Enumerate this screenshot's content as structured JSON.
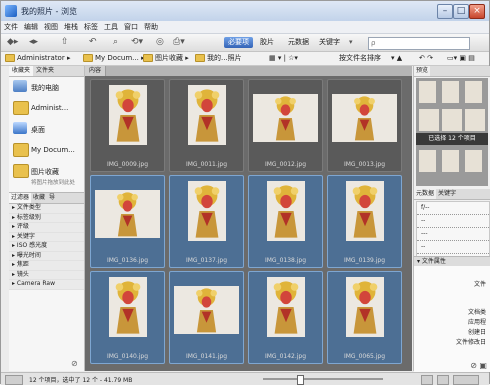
{
  "title": "我的照片 - 浏览",
  "menu": [
    "文件",
    "编辑",
    "视图",
    "堆栈",
    "标签",
    "工具",
    "窗口",
    "帮助"
  ],
  "toolbar": {
    "segments": [
      "必要项",
      "胶片",
      "元数据",
      "关键字"
    ],
    "search_placeholder": "ρ"
  },
  "path": {
    "crumbs": [
      "Administrator",
      "My Docum...",
      "图片收藏",
      "我的...照片"
    ],
    "sort_label": "按文件名排序"
  },
  "left": {
    "tabs": [
      "收藏夹",
      "文件夹"
    ],
    "favorites": [
      "我的电脑",
      "Administ...",
      "桌面",
      "My Docum...",
      "图片收藏",
      "将图片拖放到此处"
    ],
    "filter_tabs": [
      "过滤器",
      "收藏",
      "导"
    ],
    "filters": [
      "文件类型",
      "标签级别",
      "评级",
      "关键字",
      "ISO 感光度",
      "曝光时间",
      "焦距",
      "镜头",
      "Camera Raw"
    ]
  },
  "content": {
    "tab_label": "内容",
    "thumbnails": [
      {
        "name": "IMG_0009.jpg",
        "selected": false,
        "orient": "portrait"
      },
      {
        "name": "IMG_0011.jpg",
        "selected": false,
        "orient": "portrait"
      },
      {
        "name": "IMG_0012.jpg",
        "selected": false,
        "orient": "landscape"
      },
      {
        "name": "IMG_0013.jpg",
        "selected": false,
        "orient": "landscape"
      },
      {
        "name": "IMG_0136.jpg",
        "selected": true,
        "orient": "landscape"
      },
      {
        "name": "IMG_0137.jpg",
        "selected": true,
        "orient": "portrait"
      },
      {
        "name": "IMG_0138.jpg",
        "selected": true,
        "orient": "portrait"
      },
      {
        "name": "IMG_0139.jpg",
        "selected": true,
        "orient": "portrait"
      },
      {
        "name": "IMG_0140.jpg",
        "selected": true,
        "orient": "portrait"
      },
      {
        "name": "IMG_0141.jpg",
        "selected": true,
        "orient": "landscape"
      },
      {
        "name": "IMG_0142.jpg",
        "selected": true,
        "orient": "portrait"
      },
      {
        "name": "IMG_0065.jpg",
        "selected": true,
        "orient": "portrait"
      }
    ]
  },
  "right": {
    "tabs": [
      "预览",
      "元数据",
      "关键字"
    ],
    "overlay_text": "已选择 12 个项目",
    "meta_header": "文件属性",
    "meta_keys": [
      "文件",
      "文档类",
      "应用程",
      "创建日",
      "文件修改日"
    ],
    "stack_lines": [
      "f/--",
      "--",
      "---",
      "--"
    ]
  },
  "status": {
    "text": "12 个项目，选中了 12 个 - 41.79 MB"
  },
  "colors": {
    "selected_thumb": "#4d6f94",
    "thumb_bg": "#5a5a5a",
    "content_bg": "#6b6b6b"
  }
}
